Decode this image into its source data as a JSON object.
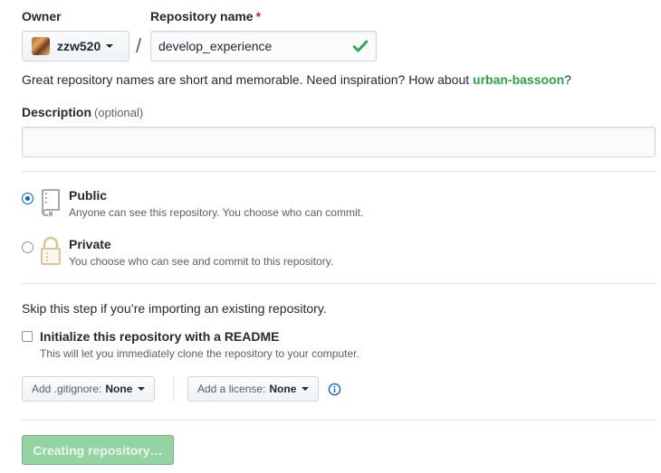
{
  "owner": {
    "label": "Owner",
    "value": "zzw520"
  },
  "repo_name": {
    "label": "Repository name",
    "required_marker": "*",
    "value": "develop_experience"
  },
  "separator": "/",
  "hint": {
    "text": "Great repository names are short and memorable. Need inspiration? How about ",
    "suggestion": "urban-bassoon",
    "end": "?"
  },
  "description": {
    "label": "Description",
    "optional_label": "(optional)",
    "value": ""
  },
  "visibility": {
    "public": {
      "title": "Public",
      "note": "Anyone can see this repository. You choose who can commit.",
      "selected": true
    },
    "private": {
      "title": "Private",
      "note": "You choose who can see and commit to this repository.",
      "selected": false
    }
  },
  "skip_text": "Skip this step if you’re importing an existing repository.",
  "readme": {
    "label": "Initialize this repository with a README",
    "note": "This will let you immediately clone the repository to your computer.",
    "checked": false
  },
  "gitignore": {
    "label": "Add .gitignore:",
    "value": "None"
  },
  "license": {
    "label": "Add a license:",
    "value": "None"
  },
  "submit_label": "Creating repository…",
  "colors": {
    "accent_blue": "#0366d6",
    "success_green": "#28a745",
    "disabled_button": "#94d3a2",
    "required_red": "#cb2431"
  },
  "icons": {
    "check": "check-icon",
    "public": "repo-icon",
    "private": "lock-icon",
    "info": "info-icon"
  }
}
